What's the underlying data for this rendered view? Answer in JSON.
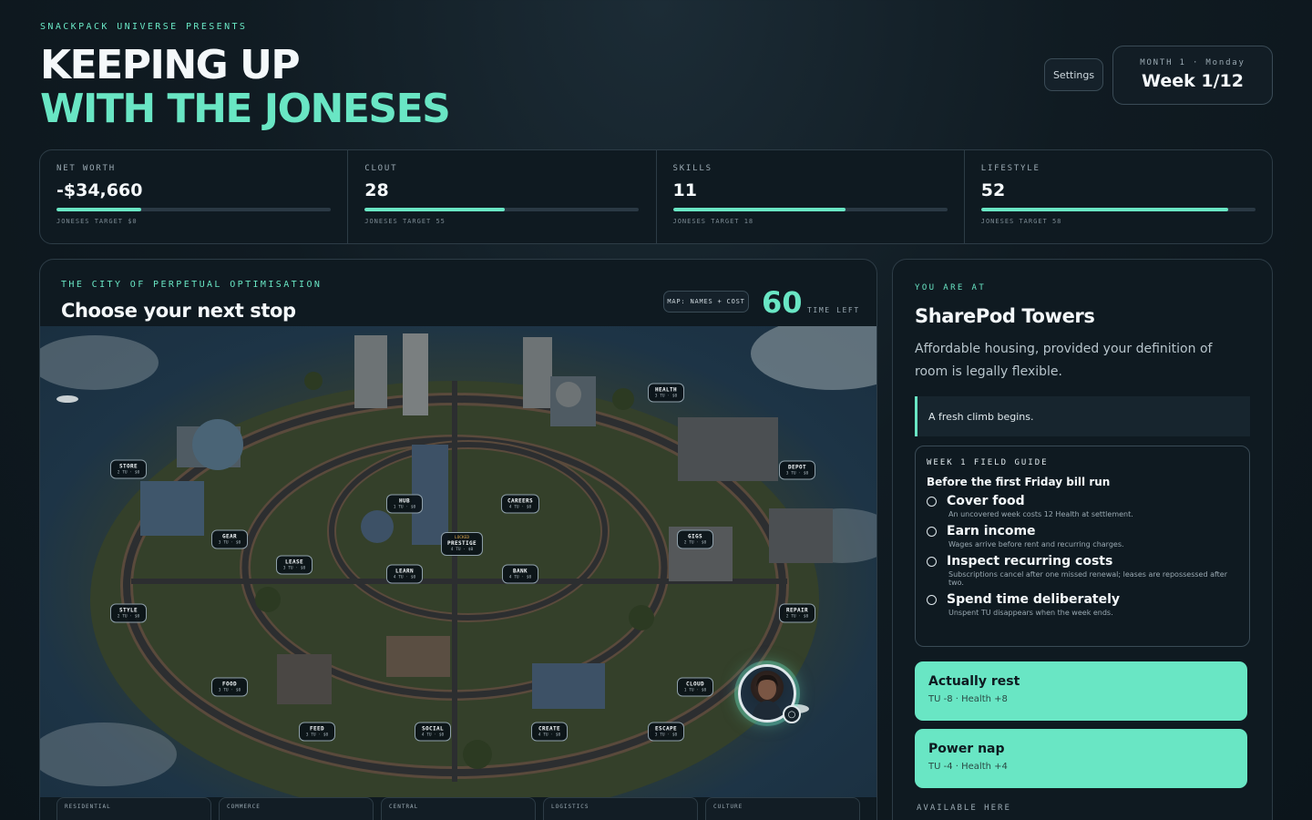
{
  "header": {
    "eyebrow": "SNACKPACK UNIVERSE PRESENTS",
    "title_line1": "KEEPING UP",
    "title_line2": "WITH THE JONESES",
    "settings_label": "Settings",
    "month_day": "MONTH 1 · Monday",
    "week": "Week 1/12"
  },
  "stats": [
    {
      "label": "NET WORTH",
      "value": "-$34,660",
      "progress": 0.31,
      "target": "JONESES TARGET $0"
    },
    {
      "label": "CLOUT",
      "value": "28",
      "progress": 0.51,
      "target": "JONESES TARGET 55"
    },
    {
      "label": "SKILLS",
      "value": "11",
      "progress": 0.63,
      "target": "JONESES TARGET 18"
    },
    {
      "label": "LIFESTYLE",
      "value": "52",
      "progress": 0.9,
      "target": "JONESES TARGET 58"
    }
  ],
  "map_panel": {
    "eyebrow": "THE CITY OF PERPETUAL OPTIMISATION",
    "heading": "Choose your next stop",
    "map_mode": "MAP: NAMES + COST",
    "time_left_value": "60",
    "time_left_label": "TIME LEFT",
    "locations": [
      {
        "name": "HEALTH",
        "cost": "3 TU · $0",
        "locked": ""
      },
      {
        "name": "STORE",
        "cost": "2 TU · $0",
        "locked": ""
      },
      {
        "name": "DEPOT",
        "cost": "3 TU · $0",
        "locked": ""
      },
      {
        "name": "HUB",
        "cost": "1 TU · $0",
        "locked": ""
      },
      {
        "name": "CAREERS",
        "cost": "4 TU · $0",
        "locked": ""
      },
      {
        "name": "PRESTIGE",
        "cost": "4 TU · $0",
        "locked": "LOCKED"
      },
      {
        "name": "GEAR",
        "cost": "3 TU · $0",
        "locked": ""
      },
      {
        "name": "GIGS",
        "cost": "2 TU · $0",
        "locked": ""
      },
      {
        "name": "LEASE",
        "cost": "3 TU · $0",
        "locked": ""
      },
      {
        "name": "LEARN",
        "cost": "4 TU · $0",
        "locked": ""
      },
      {
        "name": "BANK",
        "cost": "4 TU · $0",
        "locked": ""
      },
      {
        "name": "STYLE",
        "cost": "2 TU · $0",
        "locked": ""
      },
      {
        "name": "REPAIR",
        "cost": "2 TU · $0",
        "locked": ""
      },
      {
        "name": "FOOD",
        "cost": "3 TU · $0",
        "locked": ""
      },
      {
        "name": "CLOUD",
        "cost": "1 TU · $0",
        "locked": ""
      },
      {
        "name": "FEED",
        "cost": "3 TU · $0",
        "locked": ""
      },
      {
        "name": "SOCIAL",
        "cost": "4 TU · $0",
        "locked": ""
      },
      {
        "name": "CREATE",
        "cost": "4 TU · $0",
        "locked": ""
      },
      {
        "name": "ESCAPE",
        "cost": "3 TU · $0",
        "locked": ""
      }
    ],
    "districts": [
      "RESIDENTIAL",
      "COMMERCE",
      "CENTRAL",
      "LOGISTICS",
      "CULTURE"
    ]
  },
  "side": {
    "eyebrow": "YOU ARE AT",
    "place": "SharePod Towers",
    "description": "Affordable housing, provided your definition of room is legally flexible.",
    "note": "A fresh climb begins.",
    "guide_eyebrow": "WEEK 1 FIELD GUIDE",
    "guide_title": "Before the first Friday bill run",
    "tasks": [
      {
        "title": "Cover food",
        "desc": "An uncovered week costs 12 Health at settlement."
      },
      {
        "title": "Earn income",
        "desc": "Wages arrive before rent and recurring charges."
      },
      {
        "title": "Inspect recurring costs",
        "desc": "Subscriptions cancel after one missed renewal; leases are repossessed after two."
      },
      {
        "title": "Spend time deliberately",
        "desc": "Unspent TU disappears when the week ends."
      }
    ],
    "actions": [
      {
        "title": "Actually rest",
        "desc": "TU -8 · Health +8"
      },
      {
        "title": "Power nap",
        "desc": "TU -4 · Health +4"
      }
    ],
    "available_label": "AVAILABLE HERE"
  },
  "colors": {
    "accent": "#69e6c4",
    "background": "#101b22",
    "panel": "#0f1a21"
  }
}
